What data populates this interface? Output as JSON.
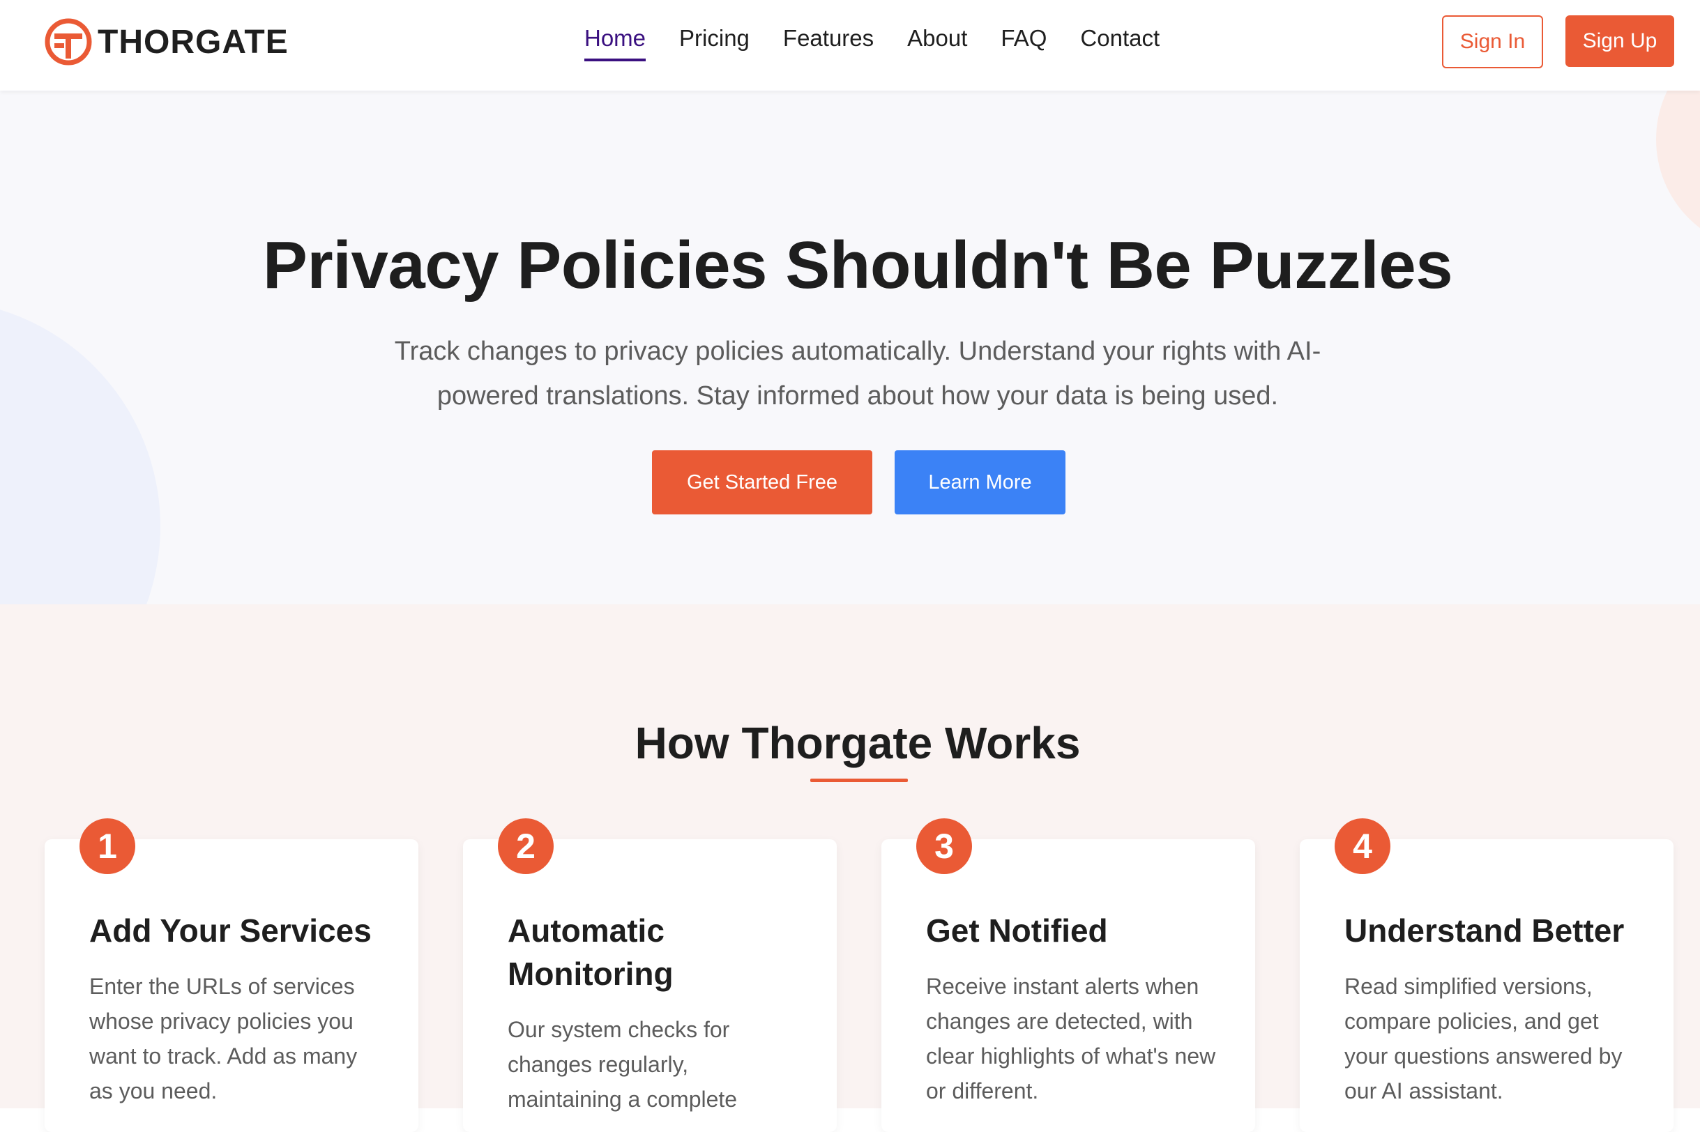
{
  "header": {
    "brand": "THORGATE",
    "nav": [
      {
        "label": "Home",
        "active": true
      },
      {
        "label": "Pricing"
      },
      {
        "label": "Features"
      },
      {
        "label": "About"
      },
      {
        "label": "FAQ"
      },
      {
        "label": "Contact"
      }
    ],
    "sign_in": "Sign In",
    "sign_up": "Sign Up"
  },
  "hero": {
    "title": "Privacy Policies Shouldn't Be Puzzles",
    "subtitle": "Track changes to privacy policies automatically. Understand your rights with AI-powered translations. Stay informed about how your data is being used.",
    "cta_primary": "Get Started Free",
    "cta_secondary": "Learn More"
  },
  "how": {
    "title": "How Thorgate Works",
    "steps": [
      {
        "number": "1",
        "title": "Add Your Services",
        "text": "Enter the URLs of services whose privacy policies you want to track. Add as many as you need."
      },
      {
        "number": "2",
        "title": "Automatic Monitoring",
        "text": "Our system checks for changes regularly, maintaining a complete"
      },
      {
        "number": "3",
        "title": "Get Notified",
        "text": "Receive instant alerts when changes are detected, with clear highlights of what's new or different."
      },
      {
        "number": "4",
        "title": "Understand Better",
        "text": "Read simplified versions, compare policies, and get your questions answered by our AI assistant."
      }
    ]
  },
  "colors": {
    "accent": "#ea5a35",
    "secondary": "#3b82f6",
    "nav_active": "#3a1080"
  },
  "icons": {
    "logo": "thorgate-logo-icon"
  }
}
